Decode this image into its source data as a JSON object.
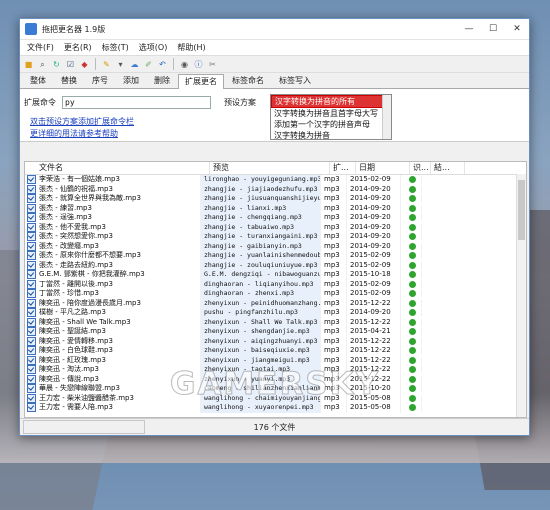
{
  "window": {
    "title": "拖把更名器 1.9版",
    "controls": [
      "—",
      "☐",
      "✕"
    ]
  },
  "menu": [
    "文件(F)",
    "更名(R)",
    "标签(T)",
    "选项(O)",
    "帮助(H)"
  ],
  "toolbar_icons": [
    "folder-open-icon",
    "search-icon",
    "refresh-icon",
    "checklist-icon",
    "tag-icon",
    "brush-icon",
    "cloud-icon",
    "edit-icon",
    "undo-icon",
    "preview-icon",
    "info-icon",
    "tools-icon"
  ],
  "tabs": [
    "整体",
    "替换",
    "序号",
    "添加",
    "删除",
    "扩展更名",
    "标签命名",
    "标签写入"
  ],
  "active_tab": "扩展更名",
  "panel": {
    "command_label": "扩展命令",
    "command_value": "py",
    "scheme_label": "预设方案",
    "schemes": [
      "汉字转换为拼音的所有",
      "汉字转换为拼音且首字母大写",
      "添加第一个汉字的拼音声母",
      "汉字转换为拼音"
    ],
    "selected_scheme_index": 0,
    "link1": "双击预设方案添加扩展命令栏",
    "link2": "更详细的用法请参考帮助"
  },
  "table": {
    "headers": [
      "文件名",
      "预览",
      "扩...",
      "日期",
      "识...",
      "結..."
    ],
    "rows": [
      {
        "name": "李荣浩 - 有一個姑娘.mp3",
        "preview": "lironghao - youyigeguniang.mp3",
        "ext": "mp3",
        "date": "2015-02-09"
      },
      {
        "name": "張杰 - 仙鶴的祝福.mp3",
        "preview": "zhangjie - jiajiaodezhufu.mp3",
        "ext": "mp3",
        "date": "2014-09-20"
      },
      {
        "name": "張杰 - 就算全世界與我為敵.mp3",
        "preview": "zhangjie - jiusuanquanshijieyu...",
        "ext": "mp3",
        "date": "2014-09-20"
      },
      {
        "name": "張杰 - 練習.mp3",
        "preview": "zhangjie - lianxi.mp3",
        "ext": "mp3",
        "date": "2014-09-20"
      },
      {
        "name": "張杰 - 逞強.mp3",
        "preview": "zhangjie - chengqiang.mp3",
        "ext": "mp3",
        "date": "2014-09-20"
      },
      {
        "name": "張杰 - 他不愛我.mp3",
        "preview": "zhangjie - tabuaiwo.mp3",
        "ext": "mp3",
        "date": "2014-09-20"
      },
      {
        "name": "張杰 - 突然想愛你.mp3",
        "preview": "zhangjie - turanxiangaini.mp3",
        "ext": "mp3",
        "date": "2014-09-20"
      },
      {
        "name": "張杰 - 改變癮.mp3",
        "preview": "zhangjie - gaibianyin.mp3",
        "ext": "mp3",
        "date": "2014-09-20"
      },
      {
        "name": "張杰 - 原來你什麼都不想要.mp3",
        "preview": "zhangjie - yuanlainishenmedouby...",
        "ext": "mp3",
        "date": "2015-02-09"
      },
      {
        "name": "張杰 - 走路去紐約.mp3",
        "preview": "zhangjie - zouluqiuniuyue.mp3",
        "ext": "mp3",
        "date": "2015-02-09"
      },
      {
        "name": "G.E.M. 鄧紫棋 - 你把我灌醉.mp3",
        "preview": "G.E.M. dengziqi - nibawoguanzu...",
        "ext": "mp3",
        "date": "2015-10-18"
      },
      {
        "name": "丁當然 - 離開以後.mp3",
        "preview": "dinghaoran - liqianyihou.mp3",
        "ext": "mp3",
        "date": "2015-02-09"
      },
      {
        "name": "丁當然 - 珍惜.mp3",
        "preview": "dinghaoran - zhenxi.mp3",
        "ext": "mp3",
        "date": "2015-02-09"
      },
      {
        "name": "陳奕迅 - 陪你度過漫長歲月.mp3",
        "preview": "zhenyixun - peinidhuomanzhang...",
        "ext": "mp3",
        "date": "2015-12-22"
      },
      {
        "name": "樸樹 - 平凡之路.mp3",
        "preview": "pushu - pingfanzhilu.mp3",
        "ext": "mp3",
        "date": "2014-09-20"
      },
      {
        "name": "陳奕迅 - Shall We Talk.mp3",
        "preview": "zhenyixun - Shall We Talk.mp3",
        "ext": "mp3",
        "date": "2015-12-22"
      },
      {
        "name": "陳奕迅 - 聖誕結.mp3",
        "preview": "zhenyixun - shengdanjie.mp3",
        "ext": "mp3",
        "date": "2015-04-21"
      },
      {
        "name": "陳奕迅 - 愛情轉移.mp3",
        "preview": "zhenyixun - aiqingzhuanyi.mp3",
        "ext": "mp3",
        "date": "2015-12-22"
      },
      {
        "name": "陳奕迅 - 白色球鞋.mp3",
        "preview": "zhenyixun - baiseqiuxie.mp3",
        "ext": "mp3",
        "date": "2015-12-22"
      },
      {
        "name": "陳奕迅 - 紅玫瑰.mp3",
        "preview": "zhenyixun - jiangmeigui.mp3",
        "ext": "mp3",
        "date": "2015-12-22"
      },
      {
        "name": "陳奕迅 - 淘汰.mp3",
        "preview": "zhenyixun - taotai.mp3",
        "ext": "mp3",
        "date": "2015-12-22"
      },
      {
        "name": "陳奕迅 - 傳說.mp3",
        "preview": "zhenyixun - yuanyi.mp3",
        "ext": "mp3",
        "date": "2015-12-22"
      },
      {
        "name": "華晨 - 失戀陣線聯盟.mp3",
        "preview": "caomeng - shilianzhenxianlianm...",
        "ext": "mp3",
        "date": "2015-10-20"
      },
      {
        "name": "王力宏 - 柴米油鹽醬醋茶.mp3",
        "preview": "wanglihong - chaimiyouyanjiang...",
        "ext": "mp3",
        "date": "2015-05-08"
      },
      {
        "name": "王力宏 - 需要人陪.mp3",
        "preview": "wanglihong - xuyaorenpei.mp3",
        "ext": "mp3",
        "date": "2015-05-08"
      }
    ]
  },
  "status": {
    "count_text": "176 个文件"
  },
  "watermark": "GAMERSKY"
}
